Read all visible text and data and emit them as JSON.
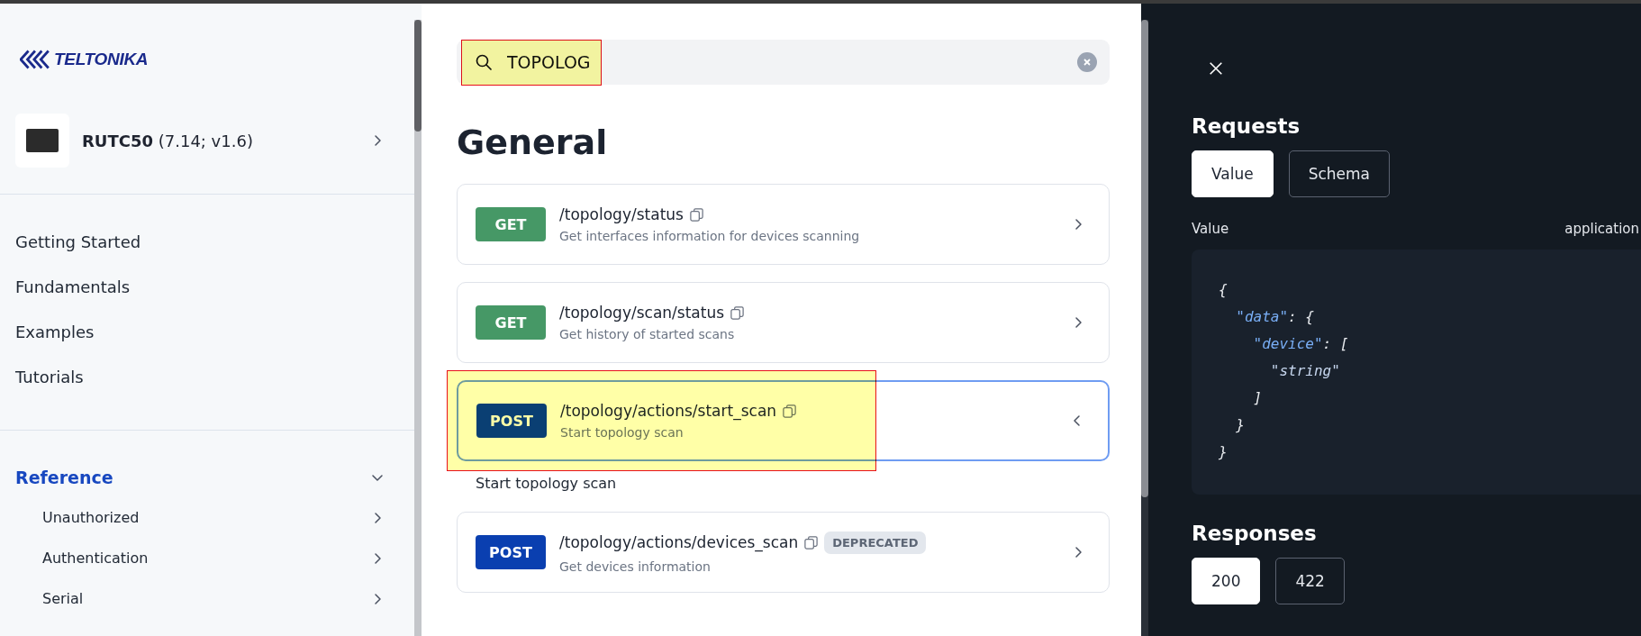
{
  "sidebar": {
    "logo": "TELTONIKA",
    "device": {
      "name": "RUTC50",
      "version": "(7.14; v1.6)"
    },
    "nav_items": [
      {
        "label": "Getting Started"
      },
      {
        "label": "Fundamentals"
      },
      {
        "label": "Examples"
      },
      {
        "label": "Tutorials"
      }
    ],
    "reference": {
      "label": "Reference",
      "expanded": true,
      "selected": true,
      "children": [
        {
          "label": "Unauthorized"
        },
        {
          "label": "Authentication"
        },
        {
          "label": "Serial"
        }
      ]
    }
  },
  "search": {
    "value": "TOPOLOG",
    "highlighted": true
  },
  "section_title": "General",
  "endpoints": [
    {
      "method": "GET",
      "path": "/topology/status",
      "description": "Get interfaces information for devices scanning",
      "expanded": false,
      "highlighted": false
    },
    {
      "method": "GET",
      "path": "/topology/scan/status",
      "description": "Get history of started scans",
      "expanded": false,
      "highlighted": false
    },
    {
      "method": "POST",
      "path": "/topology/actions/start_scan",
      "description": "Start topology scan",
      "expanded": true,
      "highlighted": true,
      "summary": "Start topology scan"
    },
    {
      "method": "POST",
      "path": "/topology/actions/devices_scan",
      "badge": "DEPRECATED",
      "description": "Get devices information",
      "expanded": false,
      "highlighted": false
    }
  ],
  "panel": {
    "requests": {
      "title": "Requests",
      "tabs": [
        {
          "label": "Value",
          "selected": true
        },
        {
          "label": "Schema",
          "selected": false
        }
      ],
      "value_label": "Value",
      "content_type": "application",
      "code_lines": [
        [
          {
            "kind": "punct",
            "text": "{"
          }
        ],
        [
          {
            "kind": "key",
            "text": "  \"data\""
          },
          {
            "kind": "punct",
            "text": ": {"
          }
        ],
        [
          {
            "kind": "key",
            "text": "    \"device\""
          },
          {
            "kind": "punct",
            "text": ": ["
          }
        ],
        [
          {
            "kind": "string",
            "text": "      \"string\""
          }
        ],
        [
          {
            "kind": "punct",
            "text": "    ]"
          }
        ],
        [
          {
            "kind": "punct",
            "text": "  }"
          }
        ],
        [
          {
            "kind": "punct",
            "text": "}"
          }
        ]
      ]
    },
    "responses": {
      "title": "Responses",
      "tabs": [
        {
          "label": "200",
          "selected": true
        },
        {
          "label": "422",
          "selected": false
        }
      ]
    }
  }
}
